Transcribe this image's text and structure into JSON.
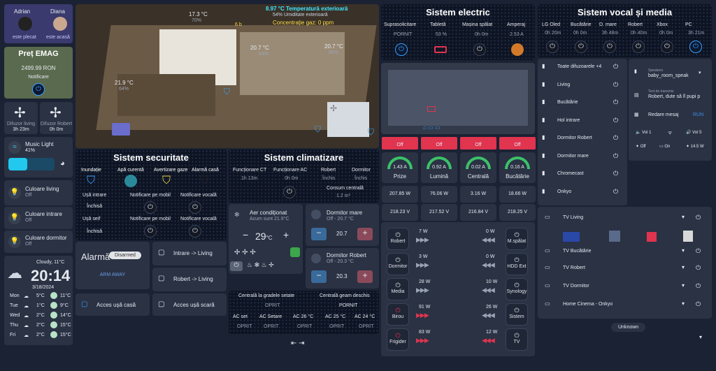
{
  "users": [
    {
      "name": "Adrian",
      "status": "este plecat"
    },
    {
      "name": "Diana",
      "status": "este acasă"
    }
  ],
  "emag": {
    "title": "Preț EMAG",
    "price": "2499.99 RON",
    "label": "Notificare"
  },
  "fans": [
    {
      "name": "Difuzor living",
      "time": "3h 23m"
    },
    {
      "name": "Difuzor Robert",
      "time": "0h 0m"
    }
  ],
  "music_light": {
    "name": "Music Light",
    "value": "41%"
  },
  "colors": [
    {
      "name": "Culoare living",
      "state": "Off"
    },
    {
      "name": "Culoare intrare",
      "state": "Off"
    },
    {
      "name": "Culoare dormitor",
      "state": "Off"
    }
  ],
  "weather": {
    "condition": "Cloudy, 11°C",
    "time": "20:14",
    "date": "3/18/2024",
    "days": [
      {
        "d": "Mon",
        "lo": "5°C",
        "hi": "11°C"
      },
      {
        "d": "Tue",
        "lo": "1°C",
        "hi": "9°C"
      },
      {
        "d": "Wed",
        "lo": "2°C",
        "hi": "14°C"
      },
      {
        "d": "Thu",
        "lo": "2°C",
        "hi": "15°C"
      },
      {
        "d": "Fri",
        "lo": "2°C",
        "hi": "15°C"
      }
    ]
  },
  "floorplan": {
    "outside": "8.97 °C Temperatură exterioară",
    "humidity": "54% Umiditate exterioară",
    "gas": "Concentrație gaz: 0 ppm",
    "rooms": [
      {
        "t": "17.3 °C",
        "h": "70%"
      },
      {
        "t": "20.7 °C",
        "h": "64%"
      },
      {
        "t": "20.7 °C",
        "h": "66%"
      },
      {
        "t": "21.9 °C",
        "h": "64%"
      }
    ],
    "small": "6 b"
  },
  "security": {
    "title": "Sistem securitate",
    "items": [
      "Inundație",
      "Apă curentă",
      "Avertizare gaze",
      "Alarmă casă"
    ],
    "row2": [
      "Ușă intrare",
      "Notificare pe mobil",
      "Notificare vocală"
    ],
    "row3": [
      "Ușă seif",
      "Notificare pe mobil",
      "Notificare vocală"
    ],
    "closed": "Închisă"
  },
  "climate": {
    "title": "Sistem climatizare",
    "items": [
      "Funcționare CT",
      "Funcționare AC",
      "Robert",
      "Dormitor"
    ],
    "vals": [
      "1h 13m",
      "0h 0m",
      "Închis",
      "Închis"
    ],
    "co2": "Consum centrală",
    "co2val": "1.2 m³"
  },
  "ac": {
    "name": "Aer condiționat",
    "sub": "Acum sunt 21.9°C",
    "temp": "29",
    "unit": "°C"
  },
  "rooms": [
    {
      "name": "Dormitor mare",
      "sub": "Off - 20.7 °C",
      "val": "20.7"
    },
    {
      "name": "Dormitor Robert",
      "sub": "Off - 20.3 °C",
      "val": "20.3"
    }
  ],
  "boiler": {
    "a": "Centrală la gradele setate",
    "b": "Centrală geam deschis",
    "av": "OPRIT",
    "bv": "PORNIT",
    "acs": [
      "AC set",
      "AC Setare",
      "AC 26 °C",
      "AC 25 °C",
      "AC 24 °C"
    ],
    "off": "OPRIT"
  },
  "alarm": {
    "title": "Alarmă",
    "badge": "Disarmed",
    "btn": "ARM AWAY"
  },
  "scenes": [
    "Intrare -> Living",
    "Robert -> Living",
    "Acces ușă casă",
    "Acces ușă scară"
  ],
  "electric": {
    "title": "Sistem electric",
    "items": [
      "Suprasolicitare",
      "Tabletă",
      "Mașina spălat",
      "Amperaj"
    ],
    "vals": [
      "PORNIT",
      "53 %",
      "0h 0m",
      "2.53 A"
    ]
  },
  "red": [
    "Off",
    "Off",
    "Off",
    "Off"
  ],
  "gauges": [
    {
      "v": "1.43 A",
      "n": "Prize"
    },
    {
      "v": "0.92 A",
      "n": "Lumină"
    },
    {
      "v": "0.02 A",
      "n": "Centrală"
    },
    {
      "v": "0.16 A",
      "n": "Bucătărie"
    }
  ],
  "watts": [
    "207.85 W",
    "76.06 W",
    "3.16 W",
    "18.66 W"
  ],
  "volts": [
    "218.23 V",
    "217.52 V",
    "216.84 V",
    "218.25 V"
  ],
  "plugs_left": [
    {
      "n": "Robert",
      "w": "7 W"
    },
    {
      "n": "Dormitor",
      "w": "3 W"
    },
    {
      "n": "Media",
      "w": "28 W"
    },
    {
      "n": "Birou",
      "w": "91 W"
    },
    {
      "n": "Frigider",
      "w": "83 W"
    }
  ],
  "plugs_right": [
    {
      "n": "M.spălat",
      "w": "0 W"
    },
    {
      "n": "HDD Ext",
      "w": "0 W"
    },
    {
      "n": "Synology",
      "w": "10 W"
    },
    {
      "n": "Sistem",
      "w": "26 W"
    },
    {
      "n": "TV",
      "w": "12 W"
    }
  ],
  "vocal": {
    "title": "Sistem vocal și media",
    "items": [
      "LG Oled",
      "Bucătărie",
      "D. mare",
      "Robert",
      "Xbox",
      "PC"
    ],
    "vals": [
      "0h 20m",
      "0h 0m",
      "3h 48m",
      "0h 40m",
      "0h 0m",
      "3h 21m"
    ]
  },
  "speakers": [
    "Toate difuzoarele +4",
    "Living",
    "Bucătărie",
    "Hol intrare",
    "Dormitor Robert",
    "Dormitor mare",
    "Chromecast",
    "Onkyo"
  ],
  "tts": {
    "speakers_label": "Speakers",
    "speaker": "baby_room_speak",
    "text_label": "Text de transmis",
    "text": "Robert, dute să îl pupi p",
    "msg": "Redare mesaj",
    "run": "RUN",
    "vol1": "Vol 1",
    "vol5": "Vol 5",
    "off": "Off",
    "on": "On",
    "vol14": "14.5 W"
  },
  "tvs": [
    "TV Living",
    "TV Bucătărie",
    "TV Robert",
    "TV Dormitor",
    "Home Cinema - Onkyo"
  ],
  "unknown": "Unknown"
}
